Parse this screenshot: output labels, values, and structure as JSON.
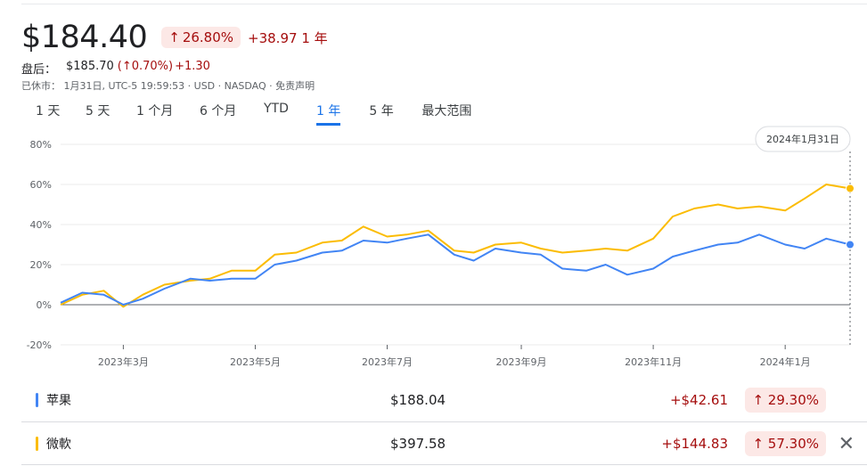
{
  "quote": {
    "price": "$184.40",
    "change_pct": "26.80%",
    "change_abs": "+38.97",
    "period": "1 年",
    "after_label": "盘后：",
    "after_price": "$185.70",
    "after_pct": "(↑0.70%)",
    "after_abs": "+1.30",
    "closed_text": "已休市：  1月31日, UTC-5 19:59:53 · USD · NASDAQ · 免责声明"
  },
  "tabs": [
    "1 天",
    "5 天",
    "1 个月",
    "6 个月",
    "YTD",
    "1 年",
    "5 年",
    "最大范围"
  ],
  "active_tab": 5,
  "tooltip_date": "2024年1月31日",
  "colors": {
    "blue": "#4285f4",
    "yellow": "#fbbc04",
    "up_red": "#a50e0e",
    "badge_bg": "#fce8e6"
  },
  "chart_data": {
    "type": "line",
    "ylim": [
      -20,
      80
    ],
    "yticks": [
      "80%",
      "60%",
      "40%",
      "20%",
      "0%",
      "-20%"
    ],
    "ytick_values": [
      80,
      60,
      40,
      20,
      0,
      -20
    ],
    "x_start": "2023-01-31",
    "x_end": "2024-01-31",
    "xticks": [
      {
        "date": "2023-03-01",
        "label": "2023年3月"
      },
      {
        "date": "2023-05-01",
        "label": "2023年5月"
      },
      {
        "date": "2023-07-01",
        "label": "2023年7月"
      },
      {
        "date": "2023-09-01",
        "label": "2023年9月"
      },
      {
        "date": "2023-11-01",
        "label": "2023年11月"
      },
      {
        "date": "2024-01-01",
        "label": "2024年1月"
      }
    ],
    "x": [
      "2023-01-31",
      "2023-02-10",
      "2023-02-20",
      "2023-03-01",
      "2023-03-10",
      "2023-03-20",
      "2023-04-01",
      "2023-04-10",
      "2023-04-20",
      "2023-05-01",
      "2023-05-10",
      "2023-05-20",
      "2023-06-01",
      "2023-06-10",
      "2023-06-20",
      "2023-07-01",
      "2023-07-10",
      "2023-07-20",
      "2023-08-01",
      "2023-08-10",
      "2023-08-20",
      "2023-09-01",
      "2023-09-10",
      "2023-09-20",
      "2023-10-01",
      "2023-10-10",
      "2023-10-20",
      "2023-11-01",
      "2023-11-10",
      "2023-11-20",
      "2023-12-01",
      "2023-12-10",
      "2023-12-20",
      "2024-01-01",
      "2024-01-10",
      "2024-01-20",
      "2024-01-31"
    ],
    "series": [
      {
        "name": "苹果",
        "color": "#4285f4",
        "values": [
          1,
          6,
          5,
          0,
          3,
          8,
          13,
          12,
          13,
          13,
          20,
          22,
          26,
          27,
          32,
          31,
          33,
          35,
          25,
          22,
          28,
          26,
          25,
          18,
          17,
          20,
          15,
          18,
          24,
          27,
          30,
          31,
          35,
          30,
          28,
          33,
          30
        ]
      },
      {
        "name": "微軟",
        "color": "#fbbc04",
        "values": [
          0,
          5,
          7,
          -1,
          5,
          10,
          12,
          13,
          17,
          17,
          25,
          26,
          31,
          32,
          39,
          34,
          35,
          37,
          27,
          26,
          30,
          31,
          28,
          26,
          27,
          28,
          27,
          33,
          44,
          48,
          50,
          48,
          49,
          47,
          53,
          60,
          58
        ]
      }
    ]
  },
  "legend": [
    {
      "name": "苹果",
      "price": "$188.04",
      "delta": "+$42.61",
      "pct": "29.30%",
      "color": "#4285f4"
    },
    {
      "name": "微軟",
      "price": "$397.58",
      "delta": "+$144.83",
      "pct": "57.30%",
      "color": "#fbbc04"
    }
  ]
}
